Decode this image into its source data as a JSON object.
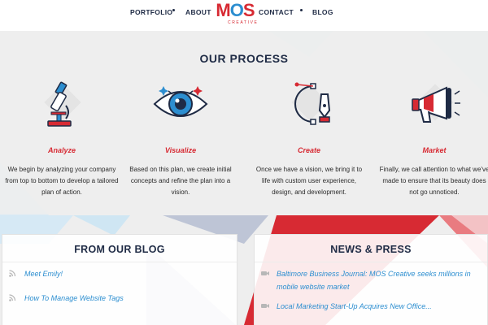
{
  "nav": {
    "links": [
      "PORTFOLIO",
      "ABOUT",
      "CONTACT",
      "BLOG"
    ],
    "logo_text": [
      "M",
      "O",
      "S"
    ],
    "logo_sub": "CREATIVE"
  },
  "process": {
    "title": "OUR PROCESS",
    "steps": [
      {
        "title": "Analyze",
        "text": "We begin by analyzing your company from top to bottom to develop a tailored plan of action.",
        "icon": "microscope-icon"
      },
      {
        "title": "Visualize",
        "text": "Based on this plan, we create initial concepts and refine the plan into a vision.",
        "icon": "eye-icon"
      },
      {
        "title": "Create",
        "text": "Once we have a vision, we bring it to life with custom user experience, design, and development.",
        "icon": "pen-tool-icon"
      },
      {
        "title": "Market",
        "text": "Finally, we call attention to what we've made to ensure that its beauty does not go unnoticed.",
        "icon": "megaphone-icon"
      }
    ]
  },
  "blog": {
    "title": "FROM OUR BLOG",
    "items": [
      "Meet Emily!",
      "How To Manage Website Tags"
    ]
  },
  "news": {
    "title": "NEWS & PRESS",
    "items": [
      "Baltimore Business Journal: MOS Creative seeks millions in mobile website market",
      "Local Marketing Start-Up Acquires New Office..."
    ]
  },
  "colors": {
    "navy": "#1f2b45",
    "red": "#d72a33",
    "blue": "#2c8ed0"
  }
}
